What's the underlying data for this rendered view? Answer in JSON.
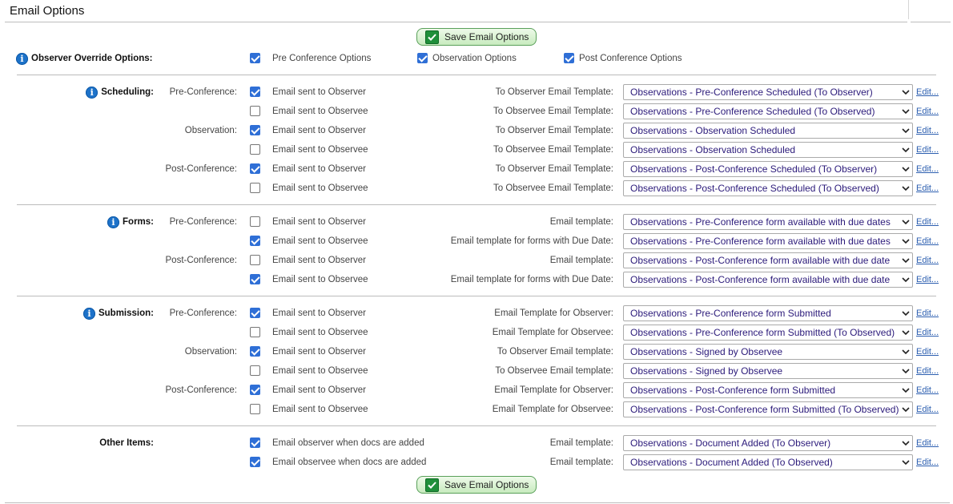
{
  "page": {
    "title": "Email Options"
  },
  "save_button": {
    "label": "Save Email Options"
  },
  "override": {
    "label": "Observer Override Options:",
    "options": [
      {
        "label": "Pre Conference Options",
        "checked": true
      },
      {
        "label": "Observation Options",
        "checked": true
      },
      {
        "label": "Post Conference Options",
        "checked": true
      }
    ]
  },
  "edit_label": "Edit...",
  "sections": [
    {
      "label": "Scheduling:",
      "rows": [
        {
          "phase": "Pre-Conference:",
          "checked": true,
          "option": "Email sent to Observer",
          "template_label": "To Observer Email Template:",
          "template": "Observations - Pre-Conference Scheduled (To Observer)"
        },
        {
          "phase": "",
          "checked": false,
          "option": "Email sent to Observee",
          "template_label": "To Observee Email Template:",
          "template": "Observations - Pre-Conference Scheduled (To Observed)"
        },
        {
          "phase": "Observation:",
          "checked": true,
          "option": "Email sent to Observer",
          "template_label": "To Observer Email Template:",
          "template": "Observations - Observation Scheduled"
        },
        {
          "phase": "",
          "checked": false,
          "option": "Email sent to Observee",
          "template_label": "To Observee Email Template:",
          "template": "Observations - Observation Scheduled"
        },
        {
          "phase": "Post-Conference:",
          "checked": true,
          "option": "Email sent to Observer",
          "template_label": "To Observer Email Template:",
          "template": "Observations - Post-Conference Scheduled (To Observer)"
        },
        {
          "phase": "",
          "checked": false,
          "option": "Email sent to Observee",
          "template_label": "To Observee Email Template:",
          "template": "Observations - Post-Conference Scheduled (To Observed)"
        }
      ]
    },
    {
      "label": "Forms:",
      "rows": [
        {
          "phase": "Pre-Conference:",
          "checked": false,
          "option": "Email sent to Observer",
          "template_label": "Email template:",
          "template": "Observations - Pre-Conference form available with due dates"
        },
        {
          "phase": "",
          "checked": true,
          "option": "Email sent to Observee",
          "template_label": "Email template for forms with Due Date:",
          "template": "Observations - Pre-Conference form available with due dates"
        },
        {
          "phase": "Post-Conference:",
          "checked": false,
          "option": "Email sent to Observer",
          "template_label": "Email template:",
          "template": "Observations - Post-Conference form available with due date"
        },
        {
          "phase": "",
          "checked": true,
          "option": "Email sent to Observee",
          "template_label": "Email template for forms with Due Date:",
          "template": "Observations - Post-Conference form available with due date"
        }
      ]
    },
    {
      "label": "Submission:",
      "rows": [
        {
          "phase": "Pre-Conference:",
          "checked": true,
          "option": "Email sent to Observer",
          "template_label": "Email Template for Observer:",
          "template": "Observations - Pre-Conference form Submitted"
        },
        {
          "phase": "",
          "checked": false,
          "option": "Email sent to Observee",
          "template_label": "Email Template for Observee:",
          "template": "Observations - Pre-Conference form Submitted (To Observed)"
        },
        {
          "phase": "Observation:",
          "checked": true,
          "option": "Email sent to Observer",
          "template_label": "To Observer Email template:",
          "template": "Observations - Signed by Observee"
        },
        {
          "phase": "",
          "checked": false,
          "option": "Email sent to Observee",
          "template_label": "To Observee Email template:",
          "template": "Observations - Signed by Observee"
        },
        {
          "phase": "Post-Conference:",
          "checked": true,
          "option": "Email sent to Observer",
          "template_label": "Email Template for Observer:",
          "template": "Observations - Post-Conference form Submitted"
        },
        {
          "phase": "",
          "checked": false,
          "option": "Email sent to Observee",
          "template_label": "Email Template for Observee:",
          "template": "Observations - Post-Conference form Submitted (To Observed)"
        }
      ]
    },
    {
      "label": "Other Items:",
      "rows": [
        {
          "phase": "",
          "checked": true,
          "option": "Email observer when docs are added",
          "template_label": "Email template:",
          "template": "Observations - Document Added (To Observer)"
        },
        {
          "phase": "",
          "checked": true,
          "option": "Email observee when docs are added",
          "template_label": "Email template:",
          "template": "Observations - Document Added (To Observed)"
        }
      ]
    }
  ]
}
